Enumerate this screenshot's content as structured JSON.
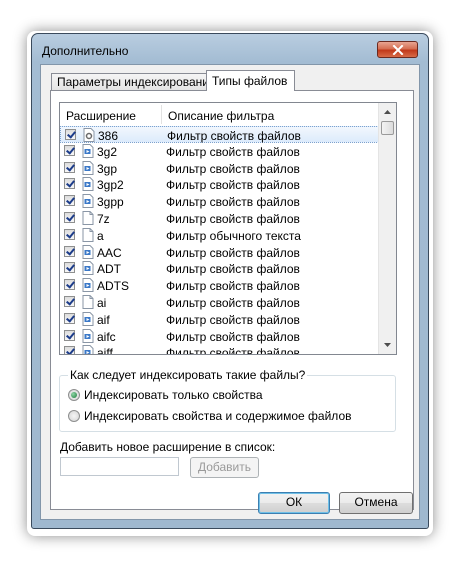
{
  "window": {
    "title": "Дополнительно"
  },
  "tabs": [
    {
      "label": "Параметры индексирования",
      "active": false
    },
    {
      "label": "Типы файлов",
      "active": true
    }
  ],
  "list": {
    "columns": {
      "extension": "Расширение",
      "description": "Описание фильтра"
    },
    "rows": [
      {
        "ext": "386",
        "desc": "Фильтр свойств файлов",
        "checked": true,
        "icon": "gear-file-icon",
        "selected": true
      },
      {
        "ext": "3g2",
        "desc": "Фильтр свойств файлов",
        "checked": true,
        "icon": "media-file-icon"
      },
      {
        "ext": "3gp",
        "desc": "Фильтр свойств файлов",
        "checked": true,
        "icon": "media-file-icon"
      },
      {
        "ext": "3gp2",
        "desc": "Фильтр свойств файлов",
        "checked": true,
        "icon": "media-file-icon"
      },
      {
        "ext": "3gpp",
        "desc": "Фильтр свойств файлов",
        "checked": true,
        "icon": "media-file-icon"
      },
      {
        "ext": "7z",
        "desc": "Фильтр свойств файлов",
        "checked": true,
        "icon": "blank-file-icon"
      },
      {
        "ext": "a",
        "desc": "Фильтр обычного текста",
        "checked": true,
        "icon": "blank-file-icon"
      },
      {
        "ext": "AAC",
        "desc": "Фильтр свойств файлов",
        "checked": true,
        "icon": "media-file-icon"
      },
      {
        "ext": "ADT",
        "desc": "Фильтр свойств файлов",
        "checked": true,
        "icon": "media-file-icon"
      },
      {
        "ext": "ADTS",
        "desc": "Фильтр свойств файлов",
        "checked": true,
        "icon": "media-file-icon"
      },
      {
        "ext": "ai",
        "desc": "Фильтр свойств файлов",
        "checked": true,
        "icon": "blank-file-icon"
      },
      {
        "ext": "aif",
        "desc": "Фильтр свойств файлов",
        "checked": true,
        "icon": "media-file-icon"
      },
      {
        "ext": "aifc",
        "desc": "Фильтр свойств файлов",
        "checked": true,
        "icon": "media-file-icon"
      },
      {
        "ext": "aiff",
        "desc": "Фильтр свойств файлов",
        "checked": true,
        "icon": "media-file-icon"
      }
    ]
  },
  "index_group": {
    "label": "Как следует индексировать такие файлы?",
    "options": [
      {
        "label": "Индексировать только свойства",
        "selected": true
      },
      {
        "label": "Индексировать свойства и содержимое файлов",
        "selected": false
      }
    ]
  },
  "add_extension": {
    "label": "Добавить новое расширение в список:",
    "value": "",
    "button": "Добавить"
  },
  "footer": {
    "ok": "ОК",
    "cancel": "Отмена"
  }
}
